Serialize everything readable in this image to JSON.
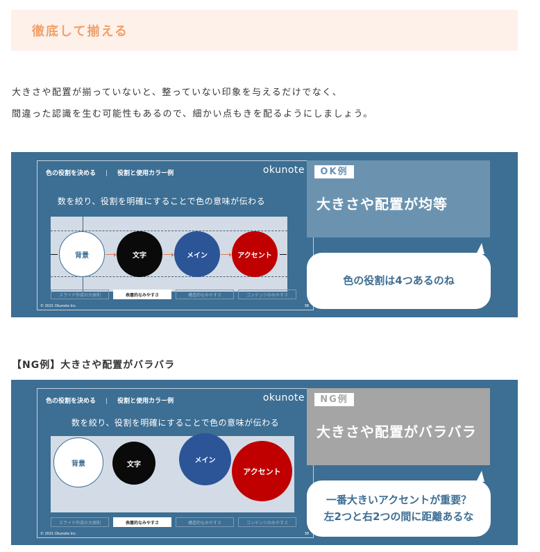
{
  "heading": {
    "title": "徹底して揃える"
  },
  "intro": {
    "line1": "大きさや配置が揃っていないと、整っていない印象を与えるだけでなく、",
    "line2": "間違った認識を生む可能性もあるので、細かい点もきを配るようにしましょう。"
  },
  "colors": {
    "panel": "#3d6e93",
    "ok_label_bg": "#6b93b0",
    "ng_label_bg": "#a5a5a5",
    "heading_text": "#f0a06a",
    "heading_bg": "#fdf1ea"
  },
  "ok_example": {
    "slide": {
      "section": "色の役割を決める",
      "subsection": "役割と使用カラー例",
      "logo": "okunote",
      "message": "数を絞り、役割を明確にすることで色の意味が伝わる",
      "circles": [
        "背景",
        "文字",
        "メイン",
        "アクセント"
      ],
      "tabs": [
        "スライド作成の大原則",
        "表層的なみやすさ",
        "構造的なみやすさ",
        "コンテンツのみやすさ"
      ],
      "active_tab": 1,
      "copyright": "© 2021  Okunote  Inc.",
      "page_number": "38"
    },
    "tag": "OK例",
    "headline": "大きさや配置が均等",
    "bubble": "色の役割は4つあるのね"
  },
  "ng_heading": "【NG例】大きさや配置がバラバラ",
  "ng_example": {
    "slide": {
      "section": "色の役割を決める",
      "subsection": "役割と使用カラー例",
      "logo": "okunote",
      "message": "数を絞り、役割を明確にすることで色の意味が伝わる",
      "circles": [
        "背景",
        "文字",
        "メイン",
        "アクセント"
      ],
      "tabs": [
        "スライド作成の大原則",
        "表層的なみやすさ",
        "構造的なみやすさ",
        "コンテンツのみやすさ"
      ],
      "active_tab": 1,
      "copyright": "© 2021  Okunote  Inc.",
      "page_number": "38"
    },
    "tag": "NG例",
    "headline": "大きさや配置がバラバラ",
    "bubble_line1": "一番大きいアクセントが重要？",
    "bubble_line2": "左2つと右2つの間に距離あるな"
  }
}
